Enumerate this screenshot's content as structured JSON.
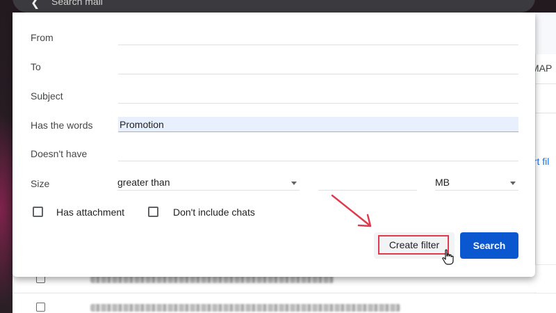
{
  "search": {
    "placeholder": "Search mail"
  },
  "gmail_bg": {
    "imap_text": "MAP",
    "export_link_text": "ort fil"
  },
  "form": {
    "from_label": "From",
    "to_label": "To",
    "subject_label": "Subject",
    "has_words_label": "Has the words",
    "has_words_value": "Promotion",
    "doesnt_have_label": "Doesn't have",
    "size_label": "Size",
    "size_operator": "greater than",
    "size_unit": "MB",
    "has_attachment_label": "Has attachment",
    "dont_include_chats_label": "Don't include chats"
  },
  "buttons": {
    "create_filter": "Create filter",
    "search": "Search"
  },
  "colors": {
    "accent": "#0b57d0",
    "highlight_box": "#e03a4e",
    "annotation_arrow": "#e03a4e"
  },
  "icons": [
    "back-arrow-icon",
    "dropdown-arrow-icon",
    "annotation-arrow-icon",
    "hand-cursor-icon"
  ]
}
